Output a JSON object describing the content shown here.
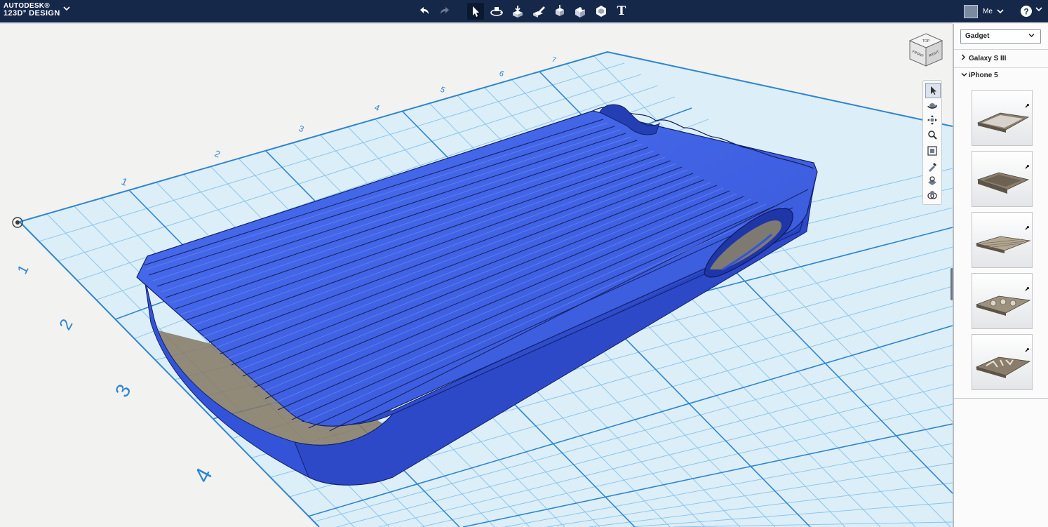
{
  "app": {
    "brand_line1": "AUTODESK®",
    "brand_line2": "123D° DESIGN",
    "brand_caret_icon": "chevron-down-icon"
  },
  "toolbar": {
    "tools": [
      "undo-icon",
      "redo-icon",
      "select-arrow-icon",
      "transform-icon",
      "primitives-icon",
      "sketch-icon",
      "construct-icon",
      "modify-icon",
      "pattern-icon",
      "text-icon"
    ],
    "text_tool_glyph": "T",
    "active_tool": "select-arrow-icon"
  },
  "account": {
    "me_label": "Me",
    "me_caret": "⌄",
    "help_caret": "⌄"
  },
  "viewport": {
    "top_axis_labels": [
      "1",
      "2",
      "3",
      "4",
      "5",
      "6",
      "7"
    ],
    "side_axis_labels": [
      "1",
      "2",
      "3",
      "4"
    ],
    "grid_color": "#3a8fd6",
    "grid_bg": "#dceef8",
    "model_color": "#3b5fe0",
    "viewcube_faces": [
      "TOP",
      "FRONT",
      "RIGHT"
    ]
  },
  "nav_bar": {
    "buttons": [
      "select-icon",
      "orbit-icon",
      "pan-icon",
      "zoom-icon",
      "fit-icon",
      "material-icon",
      "visibility-icon",
      "grouping-icon"
    ]
  },
  "panel": {
    "dropdown_value": "Gadget",
    "dropdown_caret": "⌄",
    "categories": [
      {
        "label": "Galaxy S III",
        "chevron": "›",
        "expanded": false
      },
      {
        "label": "iPhone 5",
        "chevron": "⌄",
        "expanded": true
      }
    ],
    "thumbnails": 5
  }
}
